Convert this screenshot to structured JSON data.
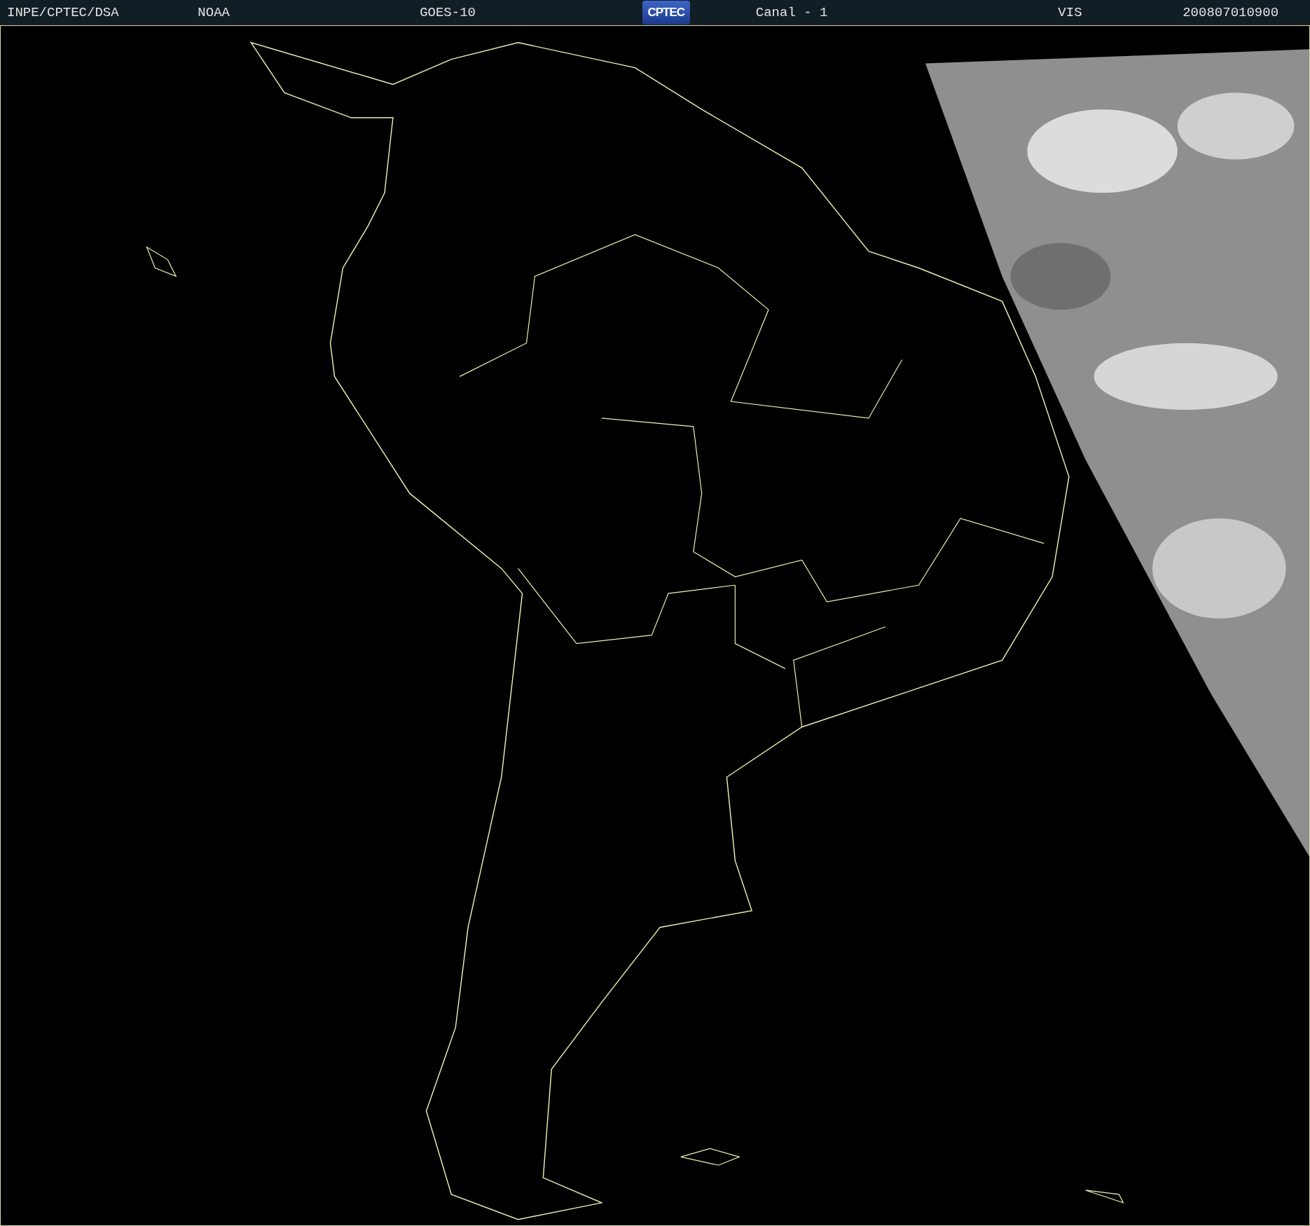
{
  "header": {
    "items": [
      "INPE/CPTEC/DSA",
      "NOAA",
      "GOES-10"
    ],
    "logo": "CPTEC",
    "items_after_logo": [
      "Canal - 1",
      "VIS",
      "200807010900"
    ]
  }
}
